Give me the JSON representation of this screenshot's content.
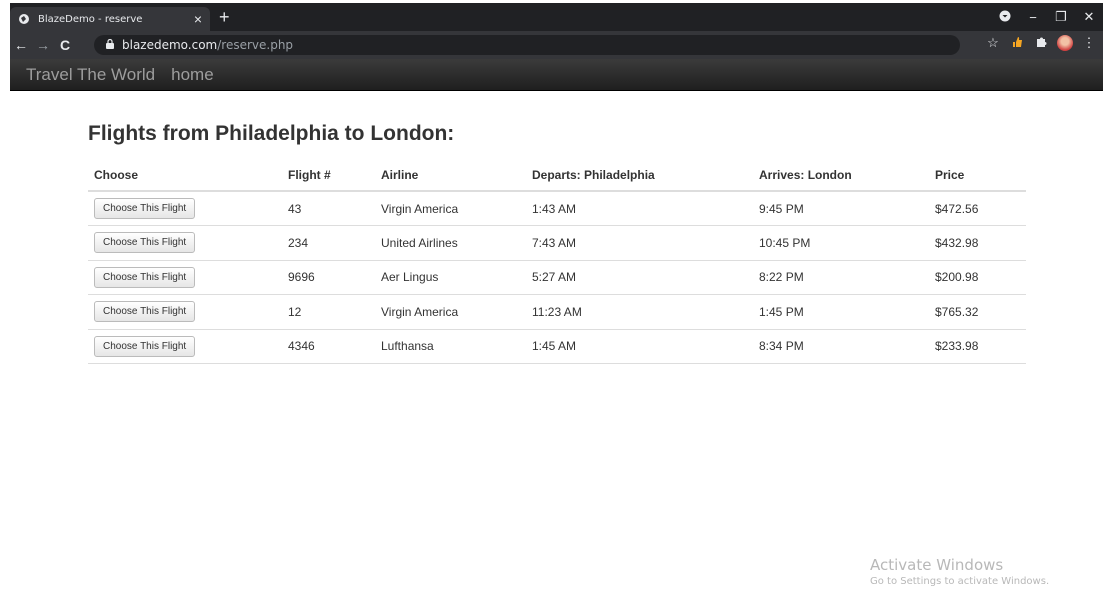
{
  "browser": {
    "tab_title": "BlazeDemo - reserve",
    "tab_close": "×",
    "new_tab": "+",
    "url_host": "blazedemo.com",
    "url_path": "/reserve.php",
    "back": "←",
    "forward": "→",
    "reload": "C",
    "lock": "🔒",
    "star": "☆",
    "menu": "⋮",
    "minimize": "−",
    "maximize": "❐",
    "close": "✕"
  },
  "navbar": {
    "brand": "Travel The World",
    "home": "home"
  },
  "page": {
    "heading": "Flights from Philadelphia to London:"
  },
  "table": {
    "headers": [
      "Choose",
      "Flight #",
      "Airline",
      "Departs: Philadelphia",
      "Arrives: London",
      "Price"
    ],
    "button_label": "Choose This Flight",
    "rows": [
      {
        "flight": "43",
        "airline": "Virgin America",
        "departs": "1:43 AM",
        "arrives": "9:45 PM",
        "price": "$472.56"
      },
      {
        "flight": "234",
        "airline": "United Airlines",
        "departs": "7:43 AM",
        "arrives": "10:45 PM",
        "price": "$432.98"
      },
      {
        "flight": "9696",
        "airline": "Aer Lingus",
        "departs": "5:27 AM",
        "arrives": "8:22 PM",
        "price": "$200.98"
      },
      {
        "flight": "12",
        "airline": "Virgin America",
        "departs": "11:23 AM",
        "arrives": "1:45 PM",
        "price": "$765.32"
      },
      {
        "flight": "4346",
        "airline": "Lufthansa",
        "departs": "1:45 AM",
        "arrives": "8:34 PM",
        "price": "$233.98"
      }
    ]
  },
  "watermark": {
    "line1": "Activate Windows",
    "line2": "Go to Settings to activate Windows."
  }
}
